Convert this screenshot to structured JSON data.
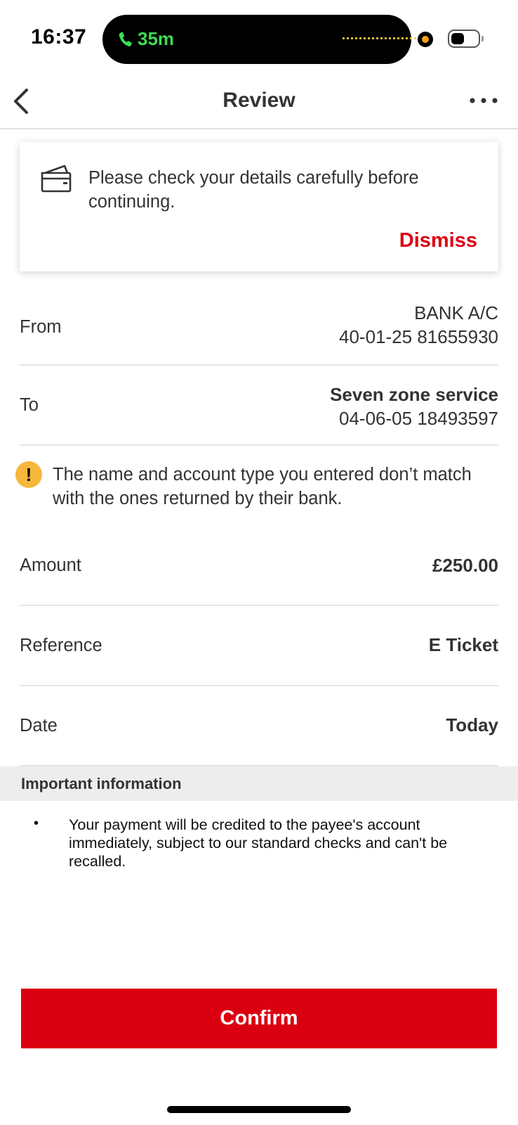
{
  "status_bar": {
    "time": "16:37",
    "call_duration": "35m"
  },
  "nav": {
    "title": "Review",
    "back_icon": "chevron-left-icon",
    "more_icon": "more-horizontal-icon"
  },
  "notice": {
    "icon": "wallet-card-icon",
    "text": "Please check your details carefully before continuing.",
    "dismiss_label": "Dismiss"
  },
  "details": {
    "from": {
      "label": "From",
      "line1": "BANK A/C",
      "line2": "40-01-25 81655930"
    },
    "to": {
      "label": "To",
      "line1": "Seven zone service",
      "line2": "04-06-05 18493597"
    },
    "warning": {
      "icon": "exclamation-icon",
      "text": "The name and account type you entered don’t match with the ones returned by their bank."
    },
    "amount": {
      "label": "Amount",
      "value": "£250.00"
    },
    "reference": {
      "label": "Reference",
      "value": "E Ticket"
    },
    "date": {
      "label": "Date",
      "value": "Today"
    }
  },
  "important_info": {
    "title": "Important information",
    "bullet": "•",
    "items": [
      "Your payment will be credited to the payee's account immediately, subject to our standard checks and can't be recalled."
    ]
  },
  "actions": {
    "confirm_label": "Confirm"
  },
  "colors": {
    "brand_red": "#db0011",
    "warning_amber": "#f6b73c",
    "call_green": "#3ddc54"
  }
}
